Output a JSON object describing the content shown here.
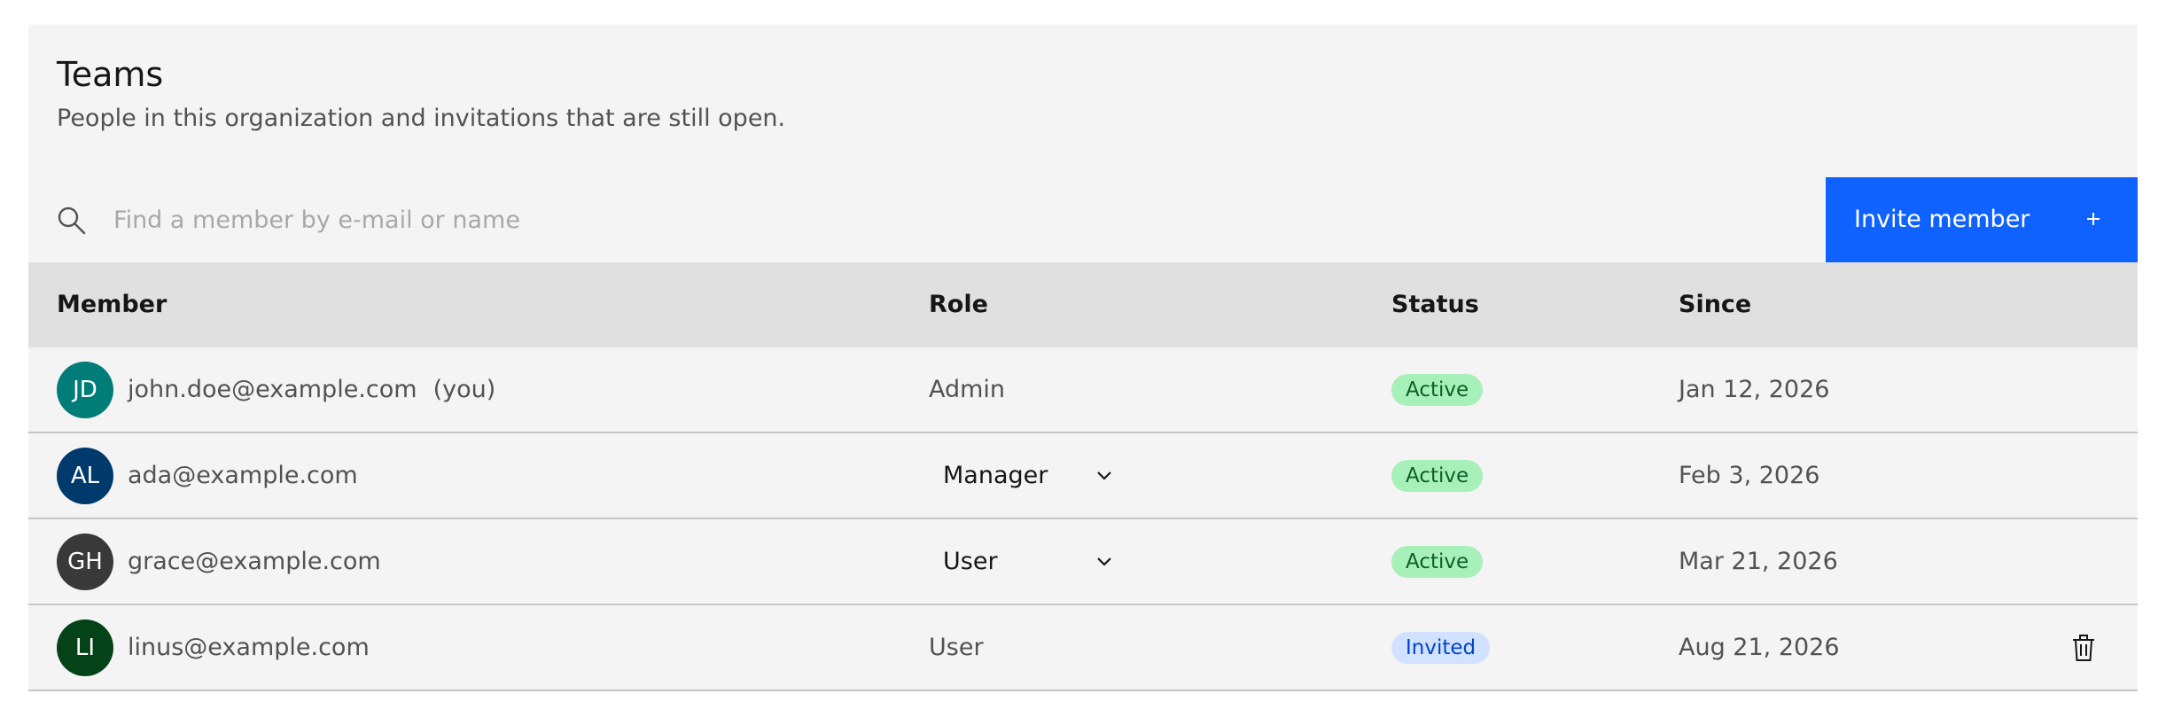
{
  "header": {
    "title": "Teams",
    "subtitle": "People in this organization and invitations that are still open."
  },
  "search": {
    "placeholder": "Find a member by e-mail or name",
    "icon": "search-icon"
  },
  "invite_button": {
    "label": "Invite member",
    "icon": "plus-icon"
  },
  "table": {
    "columns": {
      "member": "Member",
      "role": "Role",
      "status": "Status",
      "since": "Since"
    },
    "rows": [
      {
        "initials": "JD",
        "avatar_color": "#007d79",
        "email": "john.doe@example.com",
        "you_label": "(you)",
        "role": "Admin",
        "status": "Active",
        "since": "Jan 12, 2026"
      },
      {
        "initials": "AL",
        "avatar_color": "#003a6d",
        "email": "ada@example.com",
        "role": "Manager",
        "status": "Active",
        "since": "Feb 3, 2026"
      },
      {
        "initials": "GH",
        "avatar_color": "#393939",
        "email": "grace@example.com",
        "role": "User",
        "status": "Active",
        "since": "Mar 21, 2026"
      },
      {
        "initials": "LI",
        "avatar_color": "#044317",
        "email": "linus@example.com",
        "role": "User",
        "status": "Invited",
        "since": "Aug 21, 2026",
        "action_icon": "trash-icon"
      }
    ]
  },
  "colors": {
    "primary": "#0f62fe",
    "card_bg": "#f4f4f4",
    "header_bg": "#e0e0e0",
    "active_badge": "#a7f0ba",
    "invited_badge": "#d0e2ff"
  }
}
